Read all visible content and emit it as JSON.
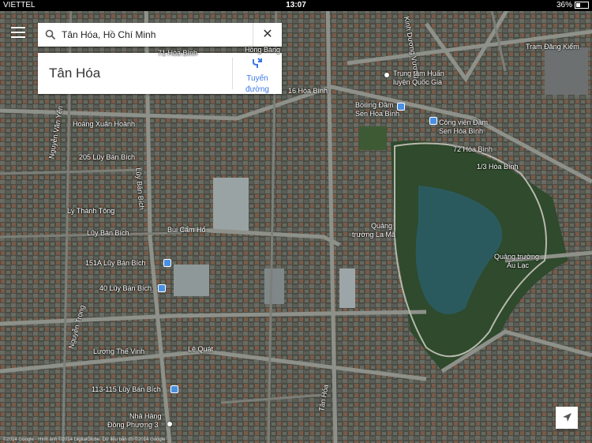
{
  "status": {
    "carrier": "VIETTEL",
    "time": "13:07",
    "battery": "36%"
  },
  "search": {
    "query": "Tân Hóa, Hồ Chí Minh"
  },
  "place": {
    "name": "Tân Hóa",
    "directions_line1": "Tuyến",
    "directions_line2": "đường"
  },
  "labels": {
    "hoa_binh_top": "71 Hòa Bình",
    "hong_bang": "Hồng Bàng",
    "kinh_duong": "Kinh Dương Vương",
    "tram_dang_kiem": "Trạm Đăng Kiểm",
    "trung_tam_1": "Trung tâm Huấn",
    "trung_tam_2": "luyện Quốc Gia",
    "hoa_binh_16": "16 Hòa Bình",
    "hoang_xuan_hoanh": "Hoàng Xuân Hoành",
    "boiling_1": "Boiling Đầm",
    "boiling_2": "Sen Hòa Bình",
    "cong_vien_1": "Công viên Đầm",
    "cong_vien_2": "Sen Hòa Bình",
    "hoa_binh_72": "72 Hòa Bình",
    "hoa_binh_13": "1/3 Hòa Bình",
    "luy_ban_bich_205": "205 Lũy Bán Bích",
    "nguyen_van_yen": "Nguyễn Văn Yến",
    "luy_ban_bich_v": "Lũy Bán Bích",
    "thanh_tong": "Lý Thánh Tông",
    "luy_ban_bich_2": "Lũy Bán Bích",
    "bui_cam_ho": "Bùi Cẩm Hổ",
    "quang_truong_1": "Quảng",
    "quang_truong_2": "trường La Mã",
    "quang_truong_au_1": "Quảng trường",
    "quang_truong_au_2": "Âu Lạc",
    "luy_ban_bich_151": "151A Lũy Bán Bích",
    "luy_ban_bich_40": "40 Lũy Bán Bích",
    "nguyen_trong": "Nguyễn Trọng",
    "luong_the_vinh": "Lương Thế Vinh",
    "le_quat": "Lê Quát",
    "luy_ban_bich_113": "113-115 Lũy Bán Bích",
    "nha_hang_1": "Nhà Hàng",
    "nha_hang_2": "Đồng Phương 3",
    "tan_hoa": "Tân Hóa",
    "copyright": "©2014 Google · Hình ảnh ©2014 DigitalGlobe, Dữ liệu bản đồ ©2014 Google"
  },
  "colors": {
    "accent": "#3b78e7",
    "water": "#2b5a5e",
    "road": "#8e918a"
  }
}
